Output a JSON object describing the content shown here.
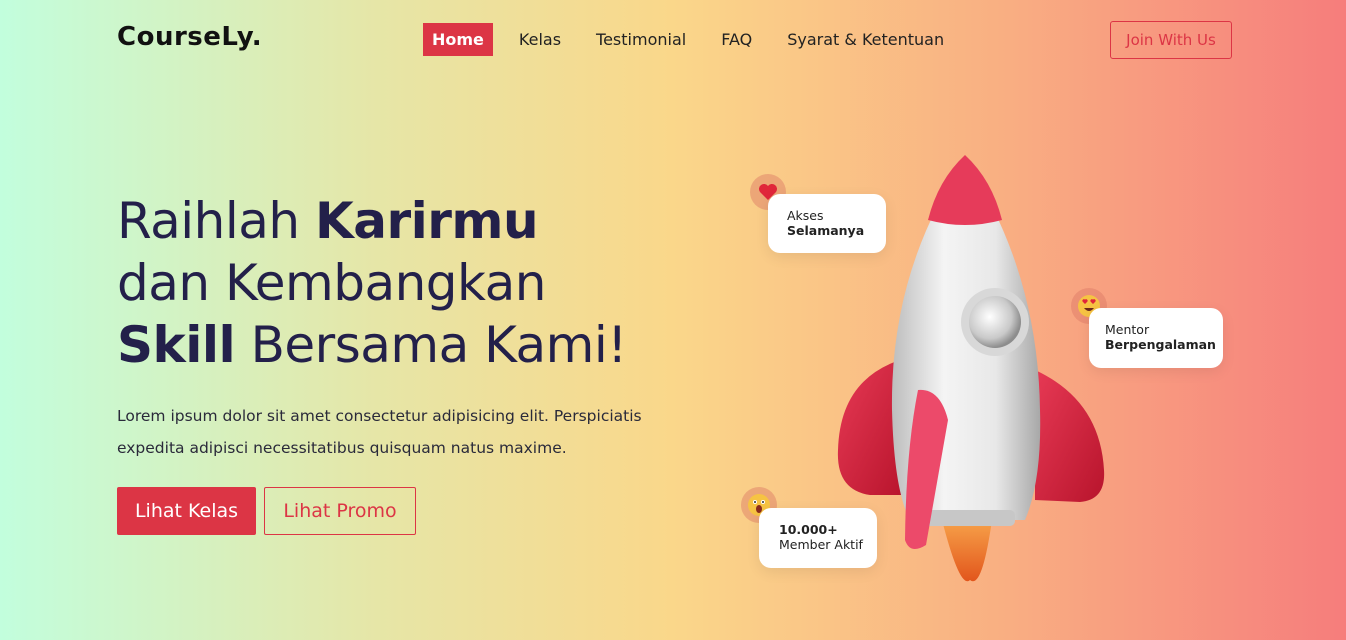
{
  "brand": {
    "logo": "CourseLy."
  },
  "nav": {
    "items": [
      "Home",
      "Kelas",
      "Testimonial",
      "FAQ",
      "Syarat & Ketentuan"
    ],
    "active": "Home",
    "join_label": "Join With Us"
  },
  "hero": {
    "title_line1_normal": "Raihlah ",
    "title_line1_bold": "Karirmu",
    "title_line2": "dan Kembangkan",
    "title_line3_bold": "Skill",
    "title_line3_normal": " Bersama Kami!",
    "description": "Lorem ipsum dolor sit amet consectetur adipisicing elit. Perspiciatis expedita adipisci necessitatibus quisquam natus maxime.",
    "primary_button": "Lihat Kelas",
    "secondary_button": "Lihat Promo"
  },
  "cards": {
    "access": {
      "line1": "Akses",
      "line2": "Selamanya",
      "icon": "heart-icon"
    },
    "mentor": {
      "line1": "Mentor",
      "line2": "Berpengalaman",
      "icon": "heart-eyes-emoji-icon"
    },
    "members": {
      "line1": "10.000+",
      "line2": "Member Aktif",
      "icon": "surprised-emoji-icon"
    }
  },
  "colors": {
    "accent": "#dc3545",
    "title": "#23204a",
    "gradient_left": "#c2fedd",
    "gradient_mid": "#fad78a",
    "gradient_right": "#f67d7c"
  }
}
